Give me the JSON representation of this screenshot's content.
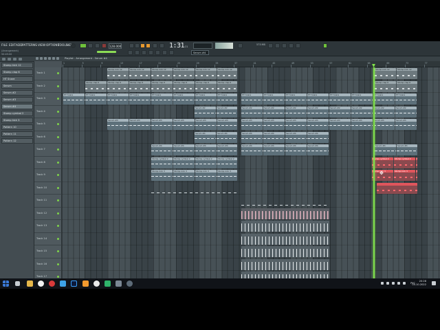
{
  "menu": [
    "FILE",
    "EDIT",
    "ADD",
    "PATTERNS",
    "VIEW",
    "OPTIONS",
    "TOOLS",
    "HELP"
  ],
  "hint_line1": "(Arrangement)",
  "hint_line2": "50:49:00",
  "tempo": "128.000",
  "time": "1:31",
  "time_sub": ":21",
  "pattern_name": "Serum #4",
  "memory": "573 MB",
  "browser_items": [
    "Stomp kick 12",
    "Stomp clap 6",
    "HT Snare",
    "Serum",
    "Serum #2",
    "Serum #3",
    "Serum #4",
    "Stomp cymbal 2",
    "Stomp kick 3",
    "Pattern 10",
    "Pattern 11",
    "Pattern 12"
  ],
  "playlist_title": "Playlist - Arrangement - Serum #4",
  "ruler_ticks": [
    "1",
    "5",
    "9",
    "13",
    "17",
    "21",
    "25",
    "29",
    "33",
    "37",
    "41",
    "45",
    "49",
    "53",
    "57",
    "61",
    "65",
    "69",
    "73",
    "77"
  ],
  "tracks": [
    "Track 1",
    "Track 2",
    "Track 3",
    "Track 4",
    "Track 5",
    "Track 6",
    "Track 7",
    "Track 8",
    "Track 9",
    "Track 10",
    "Track 11",
    "Track 12",
    "Track 13",
    "Track 14",
    "Track 15",
    "Track 16",
    "Track 17"
  ],
  "clip_labels": {
    "kick": "Stomp kick 12",
    "clap": "Stomp clap 6",
    "snare": "HT Snare",
    "serum2": "Serum #2",
    "serum3": "Serum #3",
    "serum4": "Serum #4",
    "cymbal": "Stomp cymbal 2",
    "kick3": "Stomp kick 3"
  },
  "taskbar": {
    "lang": "РУС",
    "time": "20:28",
    "date": "05.10.2022"
  },
  "colors": {
    "accent_green": "#7fe04a",
    "accent_orange": "#e7992f",
    "clip_red": "#e0555c"
  }
}
